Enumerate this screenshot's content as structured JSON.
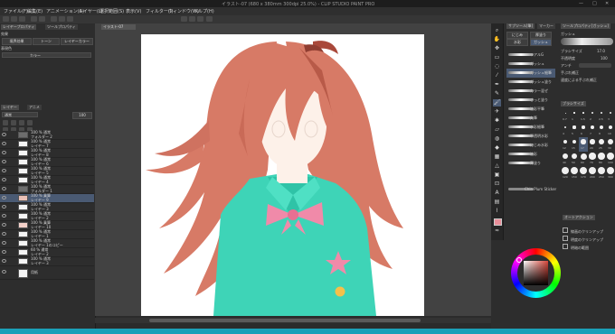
{
  "window": {
    "title": "イラスト-07 (680 x 380mm 300dpi 25.0%) - CLIP STUDIO PAINT PRO",
    "controls": [
      "—",
      "□",
      "✕"
    ]
  },
  "menu": [
    "ファイル(F)",
    "編集(E)",
    "アニメーション(A)",
    "レイヤー(L)",
    "選択範囲(S)",
    "表示(V)",
    "フィルター(I)",
    "ウィンドウ(W)",
    "ヘルプ(H)"
  ],
  "canvas_tab": "イラスト-07",
  "left_panel": {
    "tabs": [
      "レイヤープロパティ",
      "ツールプロパティ"
    ],
    "effect_label": "効果",
    "effect_buttons": [
      "境界効果",
      "トーン",
      "レイヤーカラー"
    ],
    "color_label": "表現色",
    "color_value": "カラー",
    "layer_tabs": [
      "レイヤー",
      "アニメ"
    ],
    "blend_mode": "通常",
    "opacity": "100",
    "layers": [
      {
        "pct": "100 % 通常",
        "name": "フォルダー 2",
        "type": "folder"
      },
      {
        "pct": "100 % 通常",
        "name": "レイヤー 7",
        "type": "layer"
      },
      {
        "pct": "100 % 通常",
        "name": "レイヤー 8",
        "type": "layer"
      },
      {
        "pct": "100 % 通常",
        "name": "レイヤー 6",
        "type": "layer"
      },
      {
        "pct": "100 % 通常",
        "name": "レイヤー 5",
        "type": "layer"
      },
      {
        "pct": "100 % 通常",
        "name": "レイヤー 4",
        "type": "layer"
      },
      {
        "pct": "100 % 通常",
        "name": "フォルダー 1",
        "type": "folder"
      },
      {
        "pct": "100 % 乗算",
        "name": "レイヤー 9",
        "type": "selected"
      },
      {
        "pct": "100 % 通常",
        "name": "レイヤー 3",
        "type": "layer"
      },
      {
        "pct": "100 % 通常",
        "name": "レイヤー 2",
        "type": "layer"
      },
      {
        "pct": "100 % 乗算",
        "name": "レイヤー 10",
        "type": "layer"
      },
      {
        "pct": "100 % 通常",
        "name": "レイヤー 1",
        "type": "layer"
      },
      {
        "pct": "100 % 通常",
        "name": "レイヤー 1のコピー",
        "type": "layer"
      },
      {
        "pct": "60 % 通常",
        "name": "レイヤー 2",
        "type": "layer"
      },
      {
        "pct": "100 % 通常",
        "name": "レイヤー 3",
        "type": "layer"
      },
      {
        "pct": "",
        "name": "用紙",
        "type": "paper"
      }
    ]
  },
  "sub_tool": {
    "tabs": [
      "サブツール[筆]",
      "マーカー"
    ],
    "groups": [
      "にじみ",
      "厚塗り",
      "水彩",
      "ガッシュ"
    ],
    "brushes": [
      "リアルG",
      "ガッシュ",
      "ガッシュ細筆",
      "ガッシュ塗り",
      "カラー混ぜ",
      "さっと塗り",
      "油彩平筆",
      "丸筆",
      "水彩細筆",
      "不透明水彩",
      "にじみ水彩",
      "油彩",
      "薄塗り",
      "Chin Plum Sticker"
    ]
  },
  "tool_property": {
    "tab": "ツールプロパティ[ガッシュ]",
    "tool_name": "ガッシュ",
    "rows": [
      "ブラシサイズ",
      "不透明度",
      "アンチ",
      "手ぶれ補正",
      "速度による手ぶれ補正"
    ],
    "values": [
      "17.0",
      "100"
    ]
  },
  "brush_size": {
    "tab": "ブラシサイズ",
    "sizes": [
      "0.7",
      "1",
      "1.5",
      "2",
      "2.5",
      "3",
      "4",
      "5",
      "6",
      "7",
      "8",
      "10",
      "12",
      "15",
      "17",
      "20",
      "25",
      "30",
      "40",
      "50",
      "60",
      "70",
      "80",
      "100",
      "120",
      "150",
      "170",
      "200",
      "250",
      "300"
    ]
  },
  "navigator": {
    "tab": "オートアクション",
    "rows": [
      "線画のクリンアップ",
      "明度のクリンアップ",
      "明暗の範囲"
    ]
  },
  "colors": {
    "accent": "#4a5a73",
    "status": "#1ba0b8",
    "hair": "#d77a66",
    "shirt": "#3ed4b7",
    "bow": "#f08aa9",
    "skin": "#fdf1e9"
  }
}
